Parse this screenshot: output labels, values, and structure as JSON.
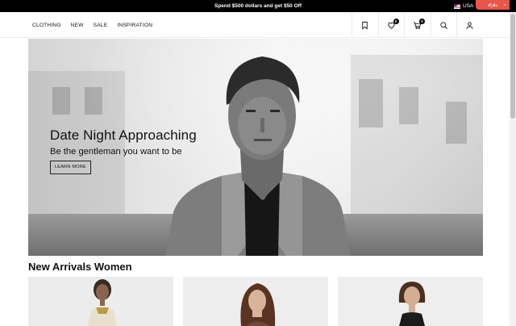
{
  "promo": {
    "text": "Spend $500 dollars and get $50 Off"
  },
  "locale": {
    "country": "USA",
    "flag_icon": "us-flag-icon"
  },
  "badge": {
    "text": "ℯ𝓅𝓈"
  },
  "nav": {
    "items": [
      {
        "label": "CLOTHING"
      },
      {
        "label": "NEW"
      },
      {
        "label": "SALE"
      },
      {
        "label": "INSPIRATION"
      }
    ]
  },
  "header_icons": {
    "bookmark": {
      "icon": "bookmark-icon"
    },
    "wishlist": {
      "icon": "heart-icon",
      "count": "0"
    },
    "cart": {
      "icon": "cart-icon",
      "count": "0"
    },
    "search": {
      "icon": "search-icon"
    },
    "account": {
      "icon": "user-icon"
    }
  },
  "hero": {
    "title": "Date Night Approaching",
    "subtitle": "Be the gentleman you want to be",
    "cta_label": "LEARN MORE"
  },
  "arrivals": {
    "title": "New Arrivals Women",
    "cards": [
      {},
      {},
      {}
    ]
  },
  "colors": {
    "promo_bg": "#000000",
    "badge_bg": "#e8554a",
    "accent": "#111111"
  }
}
